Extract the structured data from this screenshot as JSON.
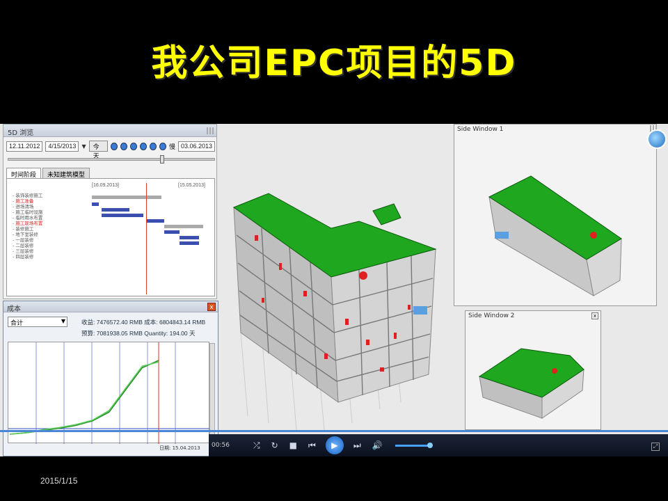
{
  "slide": {
    "title": "我公司EPC项目的5D",
    "date": "2015/1/15"
  },
  "panel5d": {
    "title": "5D 浏览",
    "start_date": "12.11.2012",
    "current_date": "4/15/2013",
    "today_label": "今天",
    "slow_label": "慢",
    "end_date": "03.06.2013",
    "tabs": [
      "时间阶段",
      "未知建筑模型"
    ],
    "gantt_header_left": "[16.09.2013]",
    "gantt_header_right": "[15.05.2013]",
    "tasks": [
      {
        "label": "- 装饰装修施工",
        "red": false
      },
      {
        "label": "  - 施工准备",
        "red": true
      },
      {
        "label": "    - 进场清场",
        "red": false
      },
      {
        "label": "    - 施工临时设施",
        "red": false
      },
      {
        "label": "    - 临时用水布置",
        "red": false
      },
      {
        "label": "    - 施工现场布置",
        "red": true
      },
      {
        "label": "  - 装修施工",
        "red": false
      },
      {
        "label": "    - 地下室装修",
        "red": false
      },
      {
        "label": "    - 一层装修",
        "red": false
      },
      {
        "label": "    - 二层装修",
        "red": false
      },
      {
        "label": "    - 三层装修",
        "red": false
      },
      {
        "label": "    - 四层装修",
        "red": false
      }
    ]
  },
  "cost": {
    "title": "成本",
    "selector": "合计",
    "figure1": "收益: 7476572.40 RMB   成本: 6804843.14 RMB",
    "figure2": "预算: 7081938.05 RMB     Quantity: 194.00 天",
    "legend": [
      {
        "label": "收益",
        "color": "#e03030"
      },
      {
        "label": "成本",
        "color": "#e050a0"
      },
      {
        "label": "预算",
        "color": "#30b030"
      },
      {
        "label": "Quant",
        "color": "#30c0c0"
      }
    ],
    "end_label": "日期: 15.04.2013",
    "chart_data": {
      "type": "line",
      "series": [
        {
          "values": [
            0,
            2,
            5,
            8,
            12,
            18,
            30,
            60,
            90,
            100
          ]
        },
        {
          "values": [
            0,
            2,
            6,
            9,
            13,
            19,
            32,
            62,
            92,
            98
          ]
        }
      ]
    }
  },
  "views": {
    "side1": "Side Window 1",
    "side2": "Side Window 2",
    "close": "x"
  },
  "media": {
    "time": "00:56"
  },
  "colors": {
    "title": "#ffff00",
    "roof": "#1fa81f",
    "pipe": "#e02020",
    "accent": "#3a7bd5"
  }
}
